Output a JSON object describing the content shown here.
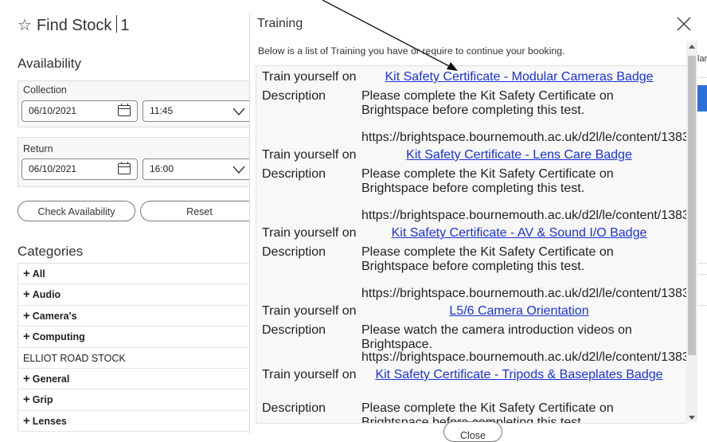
{
  "page": {
    "title": "Find Stock",
    "count": "1",
    "availability_heading": "Availability",
    "collection": {
      "label": "Collection",
      "date": "06/10/2021",
      "time": "11:45"
    },
    "return": {
      "label": "Return",
      "date": "06/10/2021",
      "time": "16:00"
    },
    "check_label": "Check Availability",
    "reset_label": "Reset",
    "categories_heading": "Categories",
    "categories": [
      {
        "label": "All",
        "expandable": true
      },
      {
        "label": "Audio",
        "expandable": true
      },
      {
        "label": "Camera's",
        "expandable": true
      },
      {
        "label": "Computing",
        "expandable": true
      },
      {
        "label": "ELLIOT ROAD STOCK",
        "expandable": false
      },
      {
        "label": "General",
        "expandable": true
      },
      {
        "label": "Grip",
        "expandable": true
      },
      {
        "label": "Lenses",
        "expandable": true
      }
    ],
    "bg_fragment": "lar"
  },
  "modal": {
    "title": "Training",
    "description": "Below is a list of Training you have or require to continue your booking.",
    "train_label": "Train yourself on",
    "desc_label": "Description",
    "items": [
      {
        "link": "Kit Safety Certificate - Modular Cameras Badge",
        "link_lines": 1,
        "desc": "Please complete the Kit Safety Certificate on Brightspace before completing this test.",
        "desc_lines": 2,
        "url": "https://brightspace.bournemouth.ac.uk/d2l/le/content/138389/Home"
      },
      {
        "link": "Kit Safety Certificate - Lens Care Badge",
        "link_lines": 1,
        "desc": "Please complete the Kit Safety Certificate on Brightspace before completing this test.",
        "desc_lines": 2,
        "url": "https://brightspace.bournemouth.ac.uk/d2l/le/content/138389/Home"
      },
      {
        "link": "Kit Safety Certificate - AV & Sound I/O Badge",
        "link_lines": 1,
        "desc": "Please complete the Kit Safety Certificate on Brightspace before completing this test.",
        "desc_lines": 2,
        "url": "https://brightspace.bournemouth.ac.uk/d2l/le/content/138389/Home"
      },
      {
        "link": "L5/6 Camera Orientation",
        "link_lines": 1,
        "desc": "Please watch the camera introduction videos on Brightspace.",
        "desc_lines": 1,
        "url": "https://brightspace.bournemouth.ac.uk/d2l/le/content/138389/Home"
      },
      {
        "link": "Kit Safety Certificate - Tripods & Baseplates Badge",
        "link_lines": 2,
        "desc": "Please complete the Kit Safety Certificate on Brightspace before completing this test.",
        "desc_lines": 2,
        "url": ""
      }
    ],
    "close_label": "Close"
  },
  "icons": {
    "star": "star-outline-icon",
    "close": "close-icon",
    "calendar": "calendar-icon",
    "chevron": "chevron-down-icon"
  },
  "colors": {
    "link": "#1a33d6",
    "accent": "#2f6fd8"
  }
}
